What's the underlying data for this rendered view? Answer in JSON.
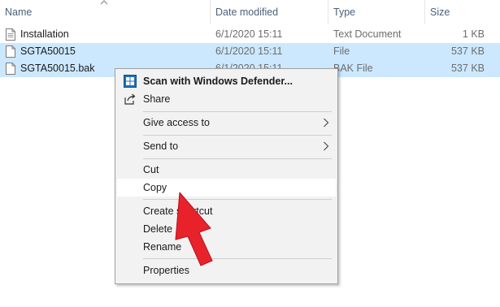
{
  "columns": {
    "name": "Name",
    "date_modified": "Date modified",
    "type": "Type",
    "size": "Size"
  },
  "files": [
    {
      "name": "Installation",
      "date": "6/1/2020 15:11",
      "type": "Text Document",
      "size": "1 KB",
      "selected": false
    },
    {
      "name": "SGTA50015",
      "date": "6/1/2020 15:11",
      "type": "File",
      "size": "537 KB",
      "selected": true
    },
    {
      "name": "SGTA50015.bak",
      "date": "6/1/2020 15:11",
      "type": "BAK File",
      "size": "537 KB",
      "selected": true
    }
  ],
  "context_menu": {
    "scan": "Scan with Windows Defender...",
    "share": "Share",
    "give_access": "Give access to",
    "send_to": "Send to",
    "cut": "Cut",
    "copy": "Copy",
    "create_shortcut": "Create shortcut",
    "delete": "Delete",
    "rename": "Rename",
    "properties": "Properties",
    "highlighted_item": "Copy"
  },
  "icons": {
    "sort": "sort-up-icon",
    "file": "document-icon",
    "defender": "windows-defender-icon",
    "share": "share-icon",
    "submenu": "chevron-right-icon",
    "annotation": "red-arrow-pointer"
  },
  "colors": {
    "selection": "#cce8ff",
    "menu_bg": "#f2f2f2",
    "menu_hover": "#ffffff",
    "arrow": "#e8222b",
    "header_text": "#4c607a"
  }
}
